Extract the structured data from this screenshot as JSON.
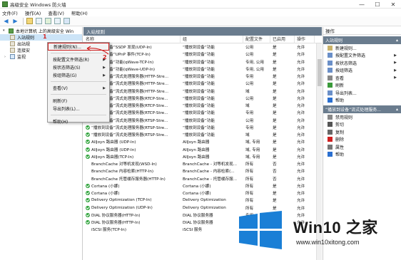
{
  "window": {
    "title": "高级安全 Windows 防火墙",
    "controls": [
      "—",
      "☐",
      "✕"
    ]
  },
  "menubar": [
    "文件(F)",
    "操作(A)",
    "查看(V)",
    "帮助(H)"
  ],
  "tree": {
    "root": "本地计算机 上的高级安全 Win",
    "items": [
      "入站规则",
      "出站规",
      "连接安",
      "监视"
    ]
  },
  "main": {
    "header": "入站规则",
    "columns": {
      "name": "名称",
      "group": "组",
      "profile": "配置文件",
      "enabled": "已启用",
      "action": "操作"
    },
    "rows": [
      {
        "name": "“播放到设备”SSDP 发现(UDP-In)",
        "group": "“播放到设备”功能",
        "profile": "公用",
        "enabled": "是",
        "action": "允许",
        "icon": false
      },
      {
        "name": "“播放到设备”UPnP 事件(TCP-In)",
        "group": "“播放到设备”功能",
        "profile": "公用",
        "enabled": "是",
        "action": "允许",
        "icon": false
      },
      {
        "name": "“播放到设备”功能(qWave-TCP-In)",
        "group": "“播放到设备”功能",
        "profile": "专用, 公用",
        "enabled": "是",
        "action": "允许",
        "icon": false
      },
      {
        "name": "“播放到设备”功能(qWave-UDP-In)",
        "group": "“播放到设备”功能",
        "profile": "专用, 公用",
        "enabled": "是",
        "action": "允许",
        "icon": false
      },
      {
        "name": "“播放到设备”流式处理服务器(HTTP-Stre...",
        "group": "“播放到设备”功能",
        "profile": "专用",
        "enabled": "是",
        "action": "允许",
        "icon": false
      },
      {
        "name": "“播放到设备”流式处理服务器(HTTP-Stre...",
        "group": "“播放到设备”功能",
        "profile": "公用",
        "enabled": "是",
        "action": "允许",
        "icon": false
      },
      {
        "name": "“播放到设备”流式处理服务器(HTTP-Stre...",
        "group": "“播放到设备”功能",
        "profile": "域",
        "enabled": "是",
        "action": "允许",
        "icon": false
      },
      {
        "name": "“播放到设备”流式处理服务器(RTCP-Stre...",
        "group": "“播放到设备”功能",
        "profile": "公用",
        "enabled": "是",
        "action": "允许",
        "icon": false
      },
      {
        "name": "“播放到设备”流式处理服务器(RTCP-Stre...",
        "group": "“播放到设备”功能",
        "profile": "域",
        "enabled": "是",
        "action": "允许",
        "icon": false
      },
      {
        "name": "“播放到设备”流式处理服务器(RTCP-Stre...",
        "group": "“播放到设备”功能",
        "profile": "专用",
        "enabled": "是",
        "action": "允许",
        "icon": true
      },
      {
        "name": "“播放到设备”流式处理服务器(RTSP-Stre...",
        "group": "“播放到设备”功能",
        "profile": "公用",
        "enabled": "是",
        "action": "允许",
        "icon": true
      },
      {
        "name": "“播放到设备”流式处理服务器(RTSP-Stre...",
        "group": "“播放到设备”功能",
        "profile": "专用",
        "enabled": "是",
        "action": "允许",
        "icon": true
      },
      {
        "name": "“播放到设备”流式处理服务器(RTSP-Stre...",
        "group": "“播放到设备”功能",
        "profile": "域",
        "enabled": "是",
        "action": "允许",
        "icon": true
      },
      {
        "name": "AllJoyn 路由器 (UDP-In)",
        "group": "AllJoyn 路由器",
        "profile": "域, 专用",
        "enabled": "是",
        "action": "允许",
        "icon": true
      },
      {
        "name": "AllJoyn 路由器 (UDP-In)",
        "group": "AllJoyn 路由器",
        "profile": "域, 专用",
        "enabled": "是",
        "action": "允许",
        "icon": true
      },
      {
        "name": "AllJoyn 路由器(TCP-In)",
        "group": "AllJoyn 路由器",
        "profile": "域, 专用",
        "enabled": "是",
        "action": "允许",
        "icon": true
      },
      {
        "name": "BranchCache 对等机发现(WSD-In)",
        "group": "BranchCache - 对等机发现...",
        "profile": "所有",
        "enabled": "否",
        "action": "允许",
        "icon": false
      },
      {
        "name": "BranchCache 内容检索(HTTP-In)",
        "group": "BranchCache - 内容检索(...",
        "profile": "所有",
        "enabled": "否",
        "action": "允许",
        "icon": false
      },
      {
        "name": "BranchCache 托管缓存服务器(HTTP-In)",
        "group": "BranchCache - 托管缓存服...",
        "profile": "所有",
        "enabled": "否",
        "action": "允许",
        "icon": false
      },
      {
        "name": "Cortana (小娜)",
        "group": "Cortana (小娜)",
        "profile": "所有",
        "enabled": "是",
        "action": "允许",
        "icon": true
      },
      {
        "name": "Cortana (小娜)",
        "group": "Cortana (小娜)",
        "profile": "所有",
        "enabled": "是",
        "action": "允许",
        "icon": true
      },
      {
        "name": "Delivery Optimization (TCP-In)",
        "group": "Delivery Optimization",
        "profile": "所有",
        "enabled": "是",
        "action": "允许",
        "icon": true
      },
      {
        "name": "Delivery Optimization (UDP-In)",
        "group": "Delivery Optimization",
        "profile": "所有",
        "enabled": "是",
        "action": "允许",
        "icon": true
      },
      {
        "name": "DIAL 协议服务器(HTTP-In)",
        "group": "DIAL 协议服务器",
        "profile": "专用",
        "enabled": "是",
        "action": "允许",
        "icon": true
      },
      {
        "name": "DIAL 协议服务器(HTTP-In)",
        "group": "DIAL 协议服务器",
        "profile": "域",
        "enabled": "是",
        "action": "允许",
        "icon": true
      },
      {
        "name": "iSCSI 服务(TCP-In)",
        "group": "iSCSI 服务",
        "profile": "",
        "enabled": "",
        "action": "",
        "icon": false
      }
    ]
  },
  "actions": {
    "header": "操作",
    "section1": "入站规则",
    "items1": [
      {
        "label": "新建规则...",
        "submenu": false
      },
      {
        "label": "按配置文件筛选",
        "submenu": true
      },
      {
        "label": "按状态筛选",
        "submenu": true
      },
      {
        "label": "按组筛选",
        "submenu": true
      },
      {
        "label": "查看",
        "submenu": true
      },
      {
        "label": "刷新",
        "submenu": false
      },
      {
        "label": "导出列表...",
        "submenu": false
      },
      {
        "label": "帮助",
        "submenu": false
      }
    ],
    "section2": "“播放到设备”流式处理服务...",
    "items2": [
      {
        "label": "禁用规则"
      },
      {
        "label": "剪切"
      },
      {
        "label": "复制"
      },
      {
        "label": "删除"
      },
      {
        "label": "属性"
      },
      {
        "label": "帮助"
      }
    ]
  },
  "context_menu": {
    "items": [
      "新建规则(N)...",
      "按配置文件筛选(R)",
      "按状态筛选(S)",
      "按组筛选(G)",
      "查看(V)",
      "刷新(F)",
      "导出列表(L)...",
      "帮助(H)"
    ],
    "submenu_items": [
      false,
      true,
      true,
      true,
      true,
      false,
      false,
      false
    ]
  },
  "annotations": [
    "1",
    "2"
  ],
  "watermark": {
    "title": "Win10 之家",
    "url": "www.win10xitong.com"
  },
  "colors": {
    "header_bg": "#6a7c8e",
    "enabled_green": "#2ea33a",
    "highlight_red": "#d02020",
    "selection_blue": "#cce4f7",
    "logo_blue": "#1a7fd6"
  }
}
